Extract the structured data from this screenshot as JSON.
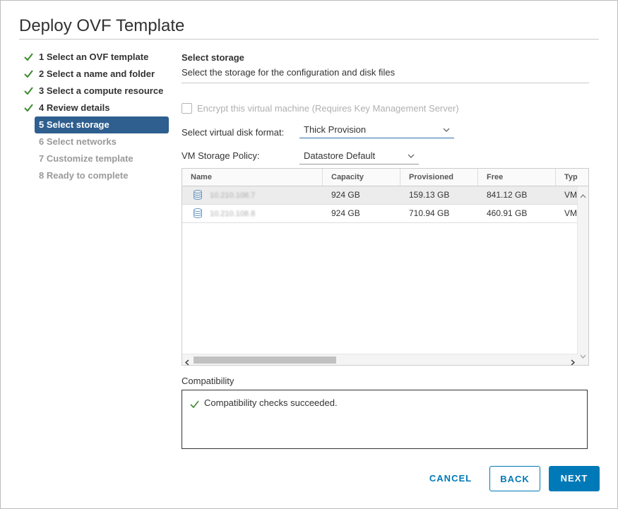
{
  "dialog": {
    "title": "Deploy OVF Template"
  },
  "steps": [
    {
      "label": "1 Select an OVF template",
      "state": "done"
    },
    {
      "label": "2 Select a name and folder",
      "state": "done"
    },
    {
      "label": "3 Select a compute resource",
      "state": "done"
    },
    {
      "label": "4 Review details",
      "state": "done"
    },
    {
      "label": "5 Select storage",
      "state": "active"
    },
    {
      "label": "6 Select networks",
      "state": "future"
    },
    {
      "label": "7 Customize template",
      "state": "future"
    },
    {
      "label": "8 Ready to complete",
      "state": "future"
    }
  ],
  "storage": {
    "heading": "Select storage",
    "subtitle": "Select the storage for the configuration and disk files",
    "encrypt_label": "Encrypt this virtual machine (Requires Key Management Server)",
    "disk_format_label": "Select virtual disk format:",
    "disk_format_value": "Thick Provision",
    "policy_label": "VM Storage Policy:",
    "policy_value": "Datastore Default"
  },
  "table": {
    "columns": [
      "Name",
      "Capacity",
      "Provisioned",
      "Free",
      "Typ"
    ],
    "rows": [
      {
        "name": "10.210.108.7",
        "capacity": "924 GB",
        "provisioned": "159.13 GB",
        "free": "841.12 GB",
        "type": "VM"
      },
      {
        "name": "10.210.108.8",
        "capacity": "924 GB",
        "provisioned": "710.94 GB",
        "free": "460.91 GB",
        "type": "VM"
      }
    ]
  },
  "compatibility": {
    "label": "Compatibility",
    "message": "Compatibility checks succeeded."
  },
  "buttons": {
    "cancel": "CANCEL",
    "back": "BACK",
    "next": "NEXT"
  },
  "colors": {
    "accent": "#0079b8",
    "active_step": "#2e5f8f",
    "check": "#3c8a2e"
  }
}
